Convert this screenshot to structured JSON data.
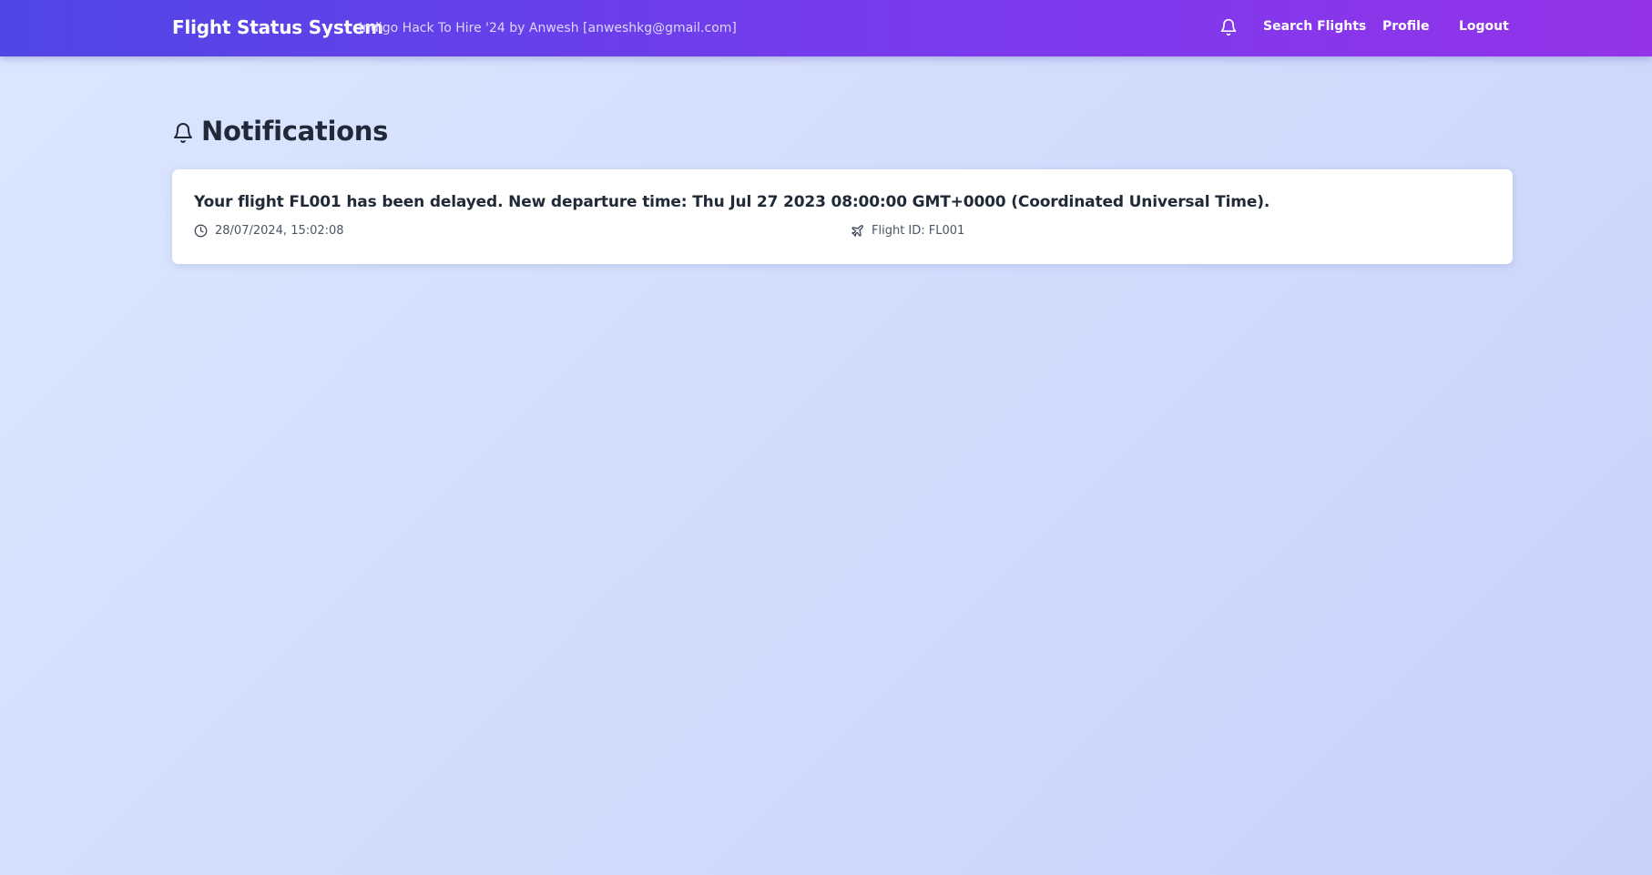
{
  "app": {
    "title": "Flight Status System",
    "tagline": "Indigo Hack To Hire '24 by Anwesh [anweshkg@gmail.com]"
  },
  "nav": {
    "bell_icon": "bell-icon",
    "links": [
      {
        "label": "Search Flights"
      },
      {
        "label": "Profile"
      },
      {
        "label": "Logout"
      }
    ]
  },
  "page": {
    "title": "Notifications",
    "title_icon": "bell-icon"
  },
  "notifications": [
    {
      "message": "Your flight FL001 has been delayed. New departure time: Thu Jul 27 2023 08:00:00 GMT+0000 (Coordinated Universal Time).",
      "timestamp": "28/07/2024, 15:02:08",
      "flight_id_text": "Flight ID: FL001",
      "time_icon": "clock-icon",
      "flight_icon": "plane-icon"
    }
  ],
  "colors": {
    "nav_gradient_start": "#4f46e5",
    "nav_gradient_end": "#9333ea",
    "background": "#d2ddfc",
    "card": "#ffffff",
    "text": "#1f2937"
  }
}
